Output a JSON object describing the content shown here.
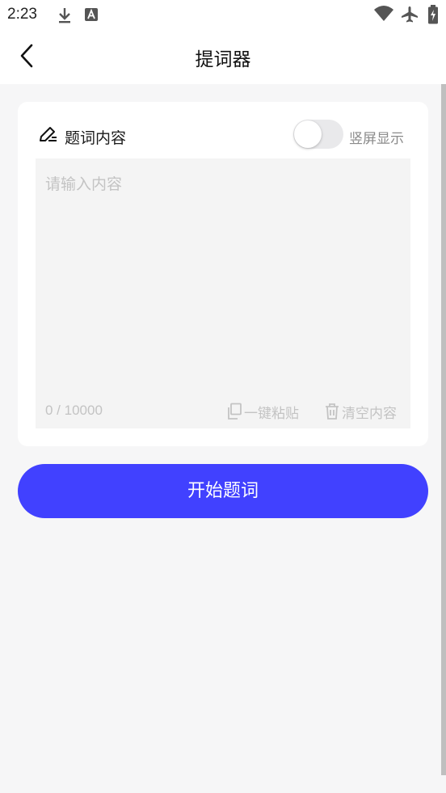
{
  "status_bar": {
    "time": "2:23",
    "icons": [
      "download-icon",
      "text-a-icon",
      "wifi-icon",
      "airplane-icon",
      "battery-charging-icon"
    ]
  },
  "header": {
    "title": "提词器",
    "back_icon": "chevron-left-icon"
  },
  "card": {
    "icon": "edit-pencil-icon",
    "label": "题词内容",
    "toggle": {
      "label": "竖屏显示",
      "on": false
    },
    "textarea": {
      "placeholder": "请输入内容",
      "value": ""
    },
    "counter": "0 / 10000",
    "paste_label": "一键粘贴",
    "clear_label": "清空内容"
  },
  "start_button": {
    "label": "开始题词"
  },
  "colors": {
    "accent": "#4141ff",
    "background": "#f6f6f7",
    "card": "#ffffff",
    "textarea_bg": "#f4f4f4",
    "muted_text": "#c3c3c3"
  }
}
